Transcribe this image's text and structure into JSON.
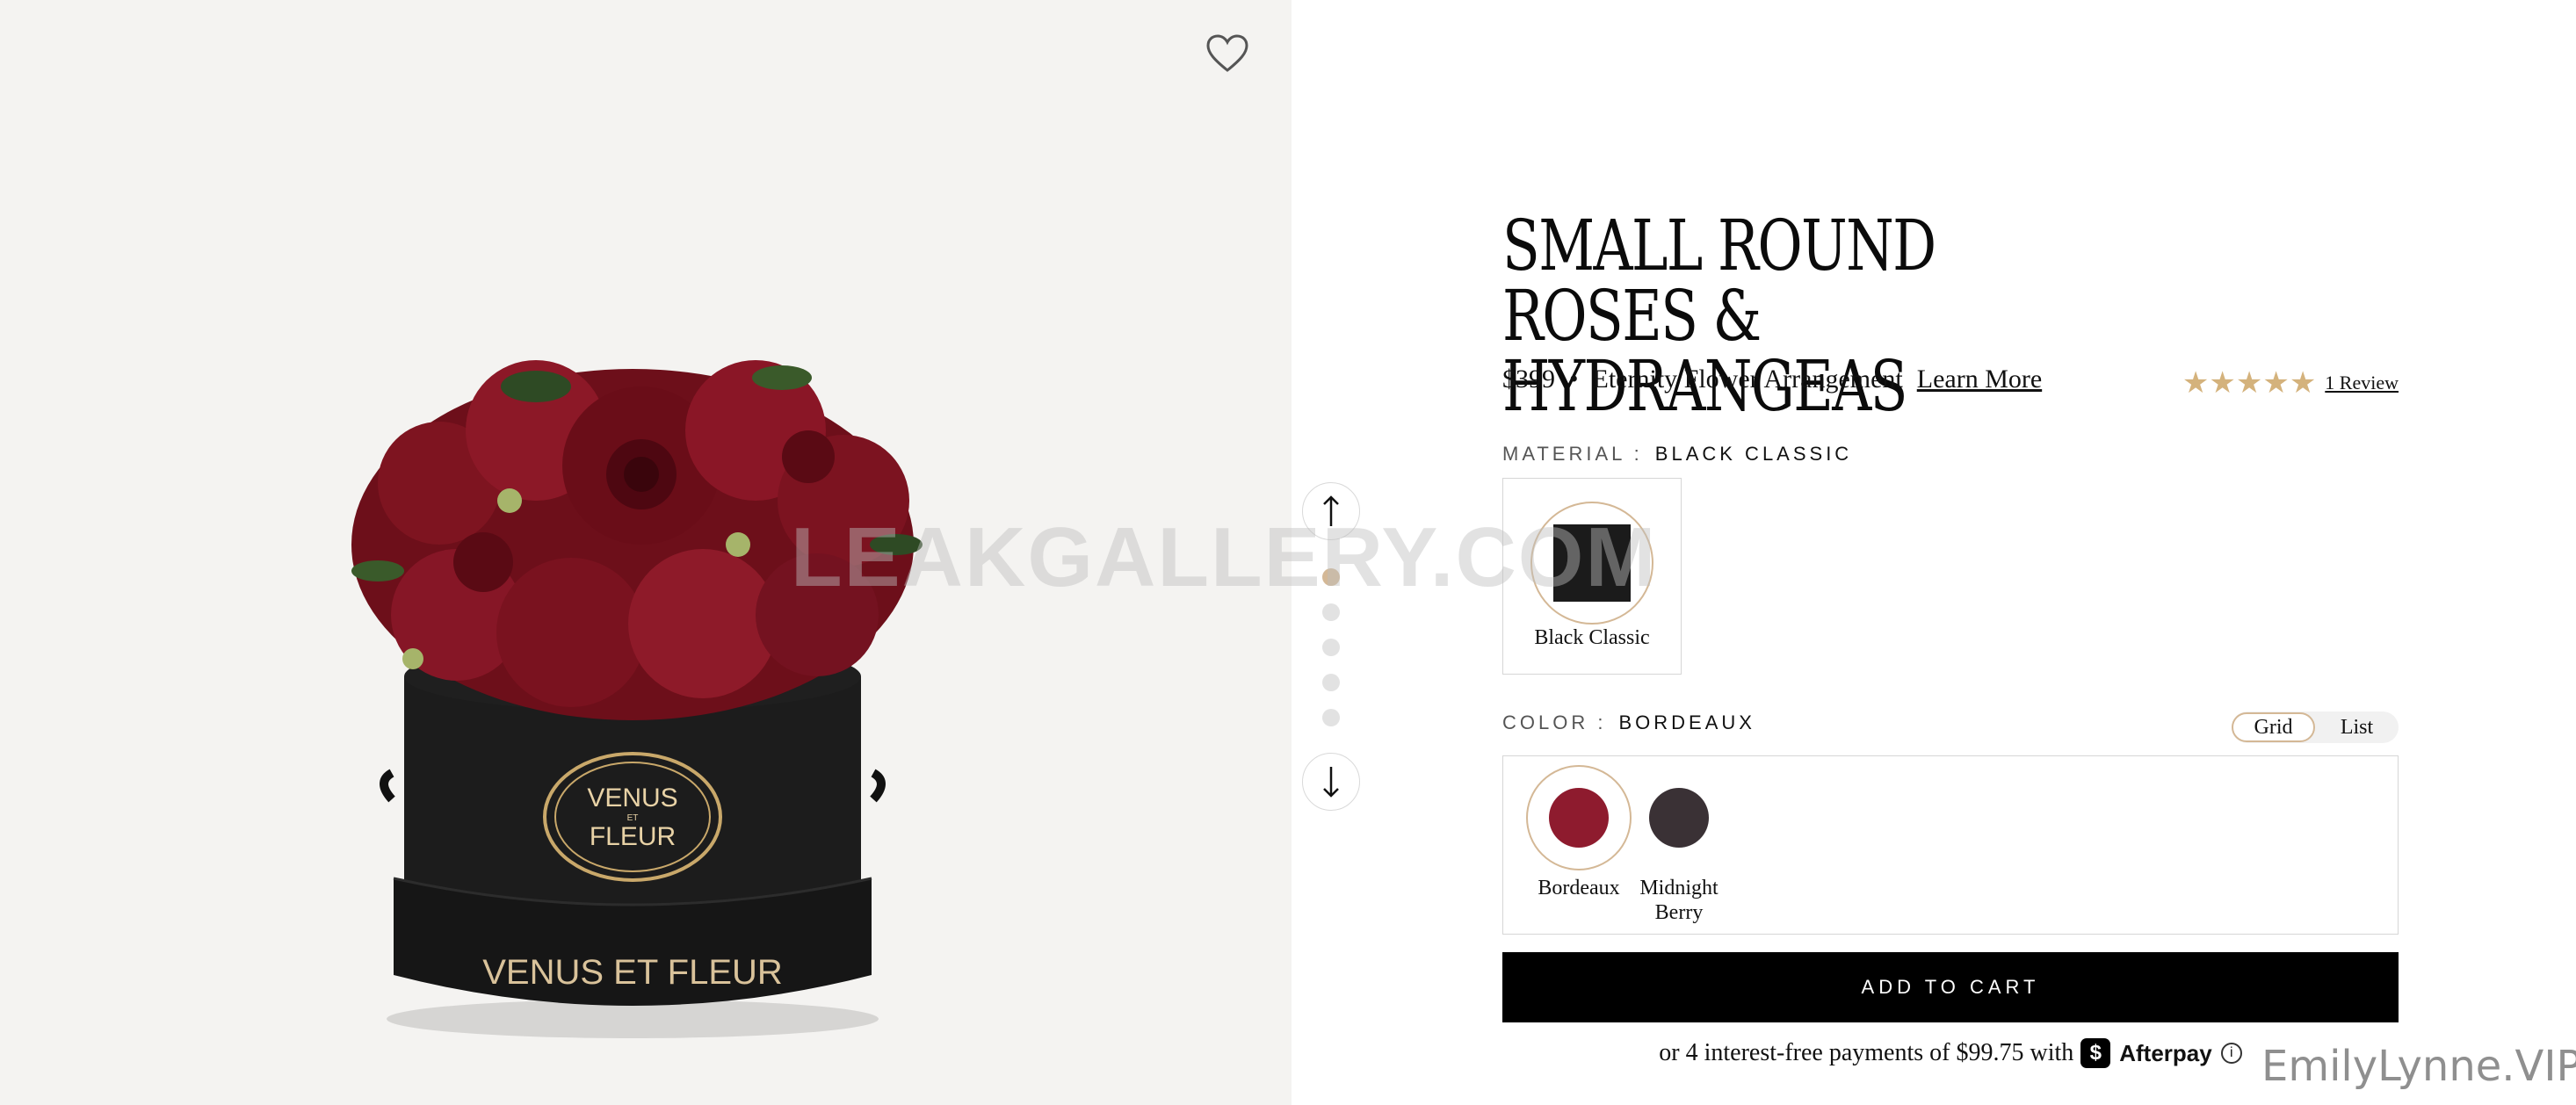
{
  "product": {
    "title": "SMALL ROUND ROSES & HYDRANGEAS",
    "price": "$399",
    "bullet": "•",
    "category": "Eternity Flower Arrangement",
    "learn_more": "Learn More",
    "rating": {
      "stars": 5,
      "review_link": "1 Review"
    }
  },
  "material": {
    "label": "MATERIAL :",
    "selected": "BLACK CLASSIC",
    "options": [
      {
        "name": "Black Classic",
        "swatch_color": "#1b1b1b"
      }
    ]
  },
  "color": {
    "label": "COLOR :",
    "selected": "BORDEAUX",
    "view_toggle": {
      "grid": "Grid",
      "list": "List",
      "active": "Grid"
    },
    "options": [
      {
        "name": "Bordeaux",
        "hex": "#8e1b2e"
      },
      {
        "name": "Midnight Berry",
        "hex": "#3a3135"
      }
    ]
  },
  "cart": {
    "label": "ADD TO CART"
  },
  "afterpay": {
    "text": "or 4 interest-free payments of $99.75 with",
    "brand": "Afterpay",
    "logo_letter": "$",
    "info": "i"
  },
  "image": {
    "box_brand_line1": "VENUS",
    "box_brand_mid": "ET",
    "box_brand_line2": "FLEUR",
    "box_base_text": "VENUS ET FLEUR"
  },
  "gallery": {
    "dot_count": 5,
    "active_index": 0
  },
  "watermarks": {
    "center": "LEAKGALLERY.COM",
    "corner": "EmilyLynne.VIP"
  },
  "colors": {
    "accent_gold": "#d4b896",
    "star_gold": "#d4b27c",
    "button_black": "#000000"
  }
}
